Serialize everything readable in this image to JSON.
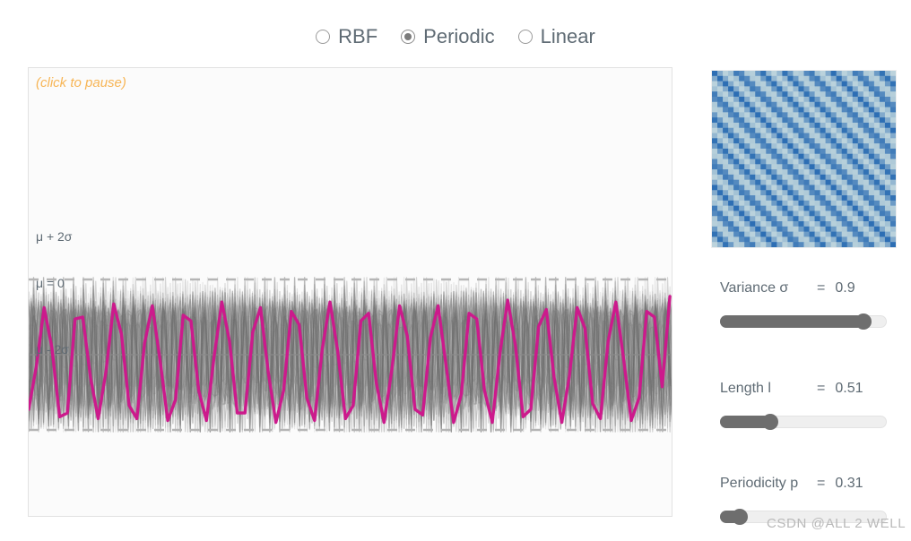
{
  "kernel_selector": {
    "options": [
      {
        "label": "RBF",
        "selected": false
      },
      {
        "label": "Periodic",
        "selected": true
      },
      {
        "label": "Linear",
        "selected": false
      }
    ]
  },
  "plot": {
    "pause_hint": "(click to pause)",
    "labels": {
      "upper": "μ + 2σ",
      "mean": "μ = 0",
      "lower": "μ - 2σ"
    },
    "colors": {
      "highlight": "#cc1a8c",
      "samples": "#8a8a8a",
      "band": "#b8b8b8",
      "hint": "#f7b555",
      "panel_bg": "#fbfbfb",
      "panel_border": "#e2e2e2"
    }
  },
  "kernel_matrix": {
    "colors": {
      "low": "#eef7ea",
      "high": "#3f7fbf",
      "mid": "#8fc4e2"
    }
  },
  "controls": [
    {
      "name": "Variance σ",
      "equals": "=",
      "value": "0.9",
      "fraction": 0.86
    },
    {
      "name": "Length l",
      "equals": "=",
      "value": "0.51",
      "fraction": 0.3
    },
    {
      "name": "Periodicity p",
      "equals": "=",
      "value": "0.31",
      "fraction": 0.12
    }
  ],
  "watermark": "CSDN @ALL 2 WELL",
  "chart_data": {
    "type": "line",
    "title": "",
    "xlabel": "",
    "ylabel": "",
    "description": "Gaussian process prior samples drawn with a Periodic kernel; many faint gray sample paths with one highlighted magenta sample, a solid mean line at mu = 0 and dashed plus/minus two sigma bounds.",
    "xlim": [
      0,
      1
    ],
    "ylim": [
      -3.2,
      3.2
    ],
    "grid": false,
    "legend": "none",
    "mean": 0,
    "band_upper": 2,
    "band_lower": -2,
    "n_samples": 40,
    "highlight_series": {
      "name": "highlighted sample",
      "color": "#cc1a8c",
      "x": [
        0.0,
        0.012,
        0.024,
        0.036,
        0.048,
        0.06,
        0.072,
        0.084,
        0.096,
        0.108,
        0.12,
        0.132,
        0.144,
        0.156,
        0.168,
        0.18,
        0.192,
        0.204,
        0.216,
        0.228,
        0.24,
        0.252,
        0.264,
        0.276,
        0.288,
        0.3,
        0.312,
        0.324,
        0.336,
        0.348,
        0.36,
        0.372,
        0.384,
        0.396,
        0.408,
        0.42,
        0.432,
        0.444,
        0.456,
        0.468,
        0.48,
        0.492,
        0.504,
        0.516,
        0.528,
        0.54,
        0.552,
        0.564,
        0.576,
        0.588,
        0.6,
        0.612,
        0.624,
        0.636,
        0.648,
        0.66,
        0.672,
        0.684,
        0.696,
        0.708,
        0.72,
        0.732,
        0.744,
        0.756,
        0.768,
        0.78,
        0.792,
        0.804,
        0.816,
        0.828,
        0.84,
        0.852,
        0.864,
        0.876,
        0.888,
        0.9,
        0.912,
        0.924,
        0.936,
        0.948,
        0.96,
        0.972,
        0.984,
        0.996
      ],
      "y": [
        -1.45,
        -0.3,
        1.25,
        0.2,
        -1.65,
        -1.55,
        0.95,
        1.0,
        -0.6,
        -1.7,
        -0.45,
        1.35,
        0.55,
        -1.35,
        -1.7,
        0.3,
        1.3,
        -0.15,
        -1.75,
        -1.2,
        1.05,
        0.9,
        -0.95,
        -1.75,
        -0.05,
        1.4,
        0.35,
        -1.55,
        -1.55,
        0.6,
        1.25,
        -0.45,
        -1.8,
        -0.95,
        1.15,
        0.8,
        -1.15,
        -1.75,
        0.15,
        1.4,
        0.1,
        -1.7,
        -1.35,
        0.9,
        1.1,
        -0.75,
        -1.8,
        -0.4,
        1.3,
        0.5,
        -1.45,
        -1.6,
        0.45,
        1.3,
        -0.25,
        -1.8,
        -1.05,
        1.1,
        0.95,
        -0.95,
        -1.8,
        0.05,
        1.45,
        0.25,
        -1.65,
        -1.45,
        0.75,
        1.2,
        -0.6,
        -1.8,
        -0.55,
        1.25,
        0.7,
        -1.3,
        -1.7,
        0.35,
        1.4,
        -0.1,
        -1.75,
        -1.15,
        1.15,
        1.0,
        -0.85,
        1.55
      ],
      "period": 0.031,
      "amplitude": 1.6
    },
    "bands": [
      {
        "name": "mu + 2sigma",
        "value": 2,
        "style": "dashed",
        "color": "#b8b8b8"
      },
      {
        "name": "mu",
        "value": 0,
        "style": "solid",
        "color": "#8a8a8a"
      },
      {
        "name": "mu - 2sigma",
        "value": -2,
        "style": "dashed",
        "color": "#b8b8b8"
      }
    ]
  }
}
